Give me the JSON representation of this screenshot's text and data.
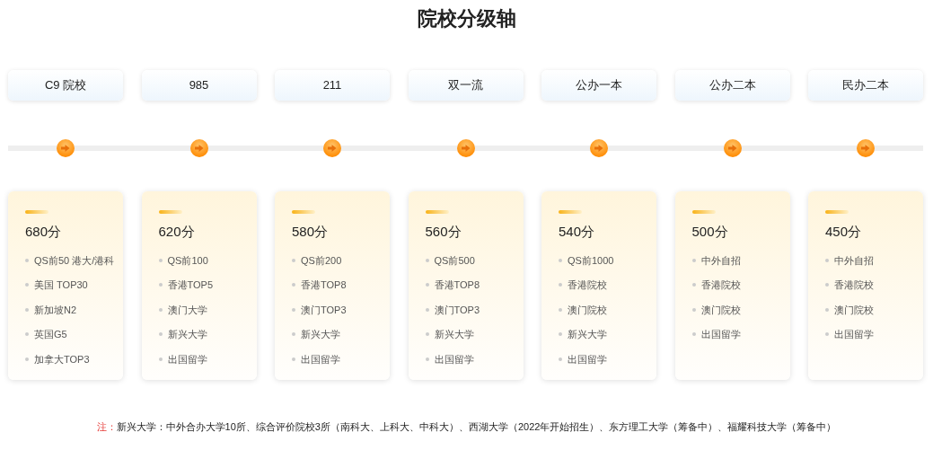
{
  "title": "院校分级轴",
  "tiers": [
    {
      "label": "C9 院校",
      "score": "680分",
      "items": [
        "QS前50 港大/港科",
        "美国 TOP30",
        "新加坡N2",
        "英国G5",
        "加拿大TOP3"
      ]
    },
    {
      "label": "985",
      "score": "620分",
      "items": [
        "QS前100",
        "香港TOP5",
        "澳门大学",
        "新兴大学",
        "出国留学"
      ]
    },
    {
      "label": "211",
      "score": "580分",
      "items": [
        "QS前200",
        "香港TOP8",
        "澳门TOP3",
        "新兴大学",
        "出国留学"
      ]
    },
    {
      "label": "双一流",
      "score": "560分",
      "items": [
        "QS前500",
        "香港TOP8",
        "澳门TOP3",
        "新兴大学",
        "出国留学"
      ]
    },
    {
      "label": "公办一本",
      "score": "540分",
      "items": [
        "QS前1000",
        "香港院校",
        "澳门院校",
        "新兴大学",
        "出国留学"
      ]
    },
    {
      "label": "公办二本",
      "score": "500分",
      "items": [
        "中外自招",
        "香港院校",
        "澳门院校",
        "出国留学"
      ]
    },
    {
      "label": "民办二本",
      "score": "450分",
      "items": [
        "中外自招",
        "香港院校",
        "澳门院校",
        "出国留学"
      ]
    }
  ],
  "note": {
    "label": "注：",
    "text": "新兴大学：中外合办大学10所、综合评价院校3所（南科大、上科大、中科大）、西湖大学（2022年开始招生）、东方理工大学（筹备中）、福耀科技大学（筹备中）"
  }
}
